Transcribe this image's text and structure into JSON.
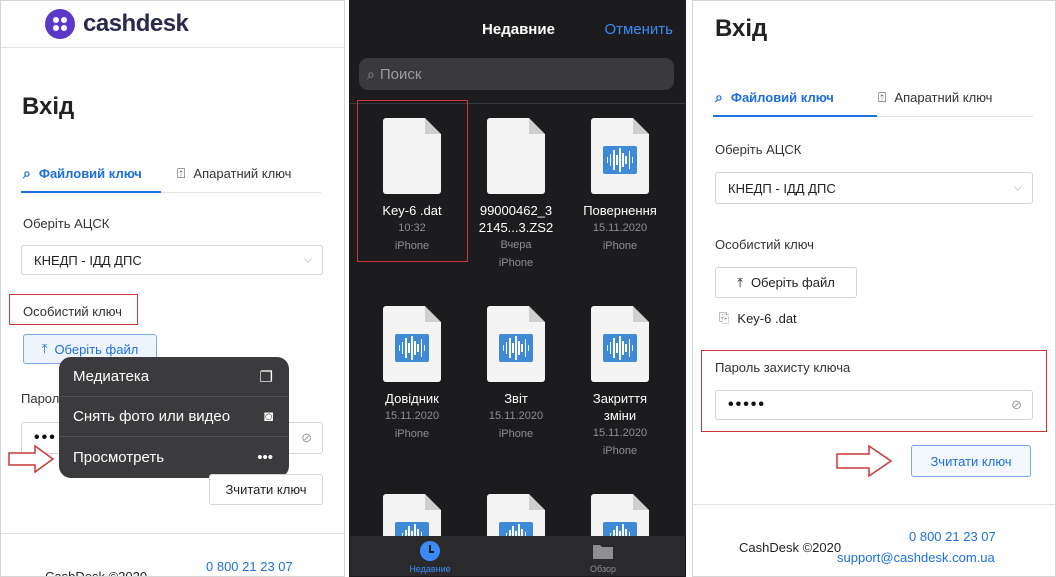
{
  "left_panel": {
    "brand": "cashdesk",
    "title": "Вхід",
    "tabs": [
      {
        "label": "Файловий ключ",
        "active": true
      },
      {
        "label": "Апаратний ключ",
        "active": false
      }
    ],
    "ca_label": "Оберіть АЦСК",
    "ca_value": "КНЕДП - ІДД ДПС",
    "key_label": "Особистий ключ",
    "choose_file": "Оберіть файл",
    "password_label_partial": "Пароль",
    "password_value": "•••",
    "context_menu": [
      {
        "label": "Медиатека",
        "icon": "gallery-icon"
      },
      {
        "label": "Снять фото или видео",
        "icon": "camera-icon"
      },
      {
        "label": "Просмотреть",
        "icon": "more-icon"
      }
    ],
    "read_key_button": "Зчитати ключ",
    "footer_phone": "0 800 21 23 07",
    "footer_copyright": "CashDesk ©2020"
  },
  "middle_panel": {
    "title": "Недавние",
    "cancel": "Отменить",
    "search_placeholder": "Поиск",
    "files": [
      {
        "name": "Key-6 .dat",
        "time": "10:32",
        "source": "iPhone",
        "kind": "doc"
      },
      {
        "name": "99000462_3 2145...3.ZS2",
        "time": "Вчера",
        "source": "iPhone",
        "kind": "doc"
      },
      {
        "name": "Повернення",
        "time": "15.11.2020",
        "source": "iPhone",
        "kind": "audio"
      },
      {
        "name": "Довідник",
        "time": "15.11.2020",
        "source": "iPhone",
        "kind": "audio"
      },
      {
        "name": "Звіт",
        "time": "15.11.2020",
        "source": "iPhone",
        "kind": "audio"
      },
      {
        "name": "Закриття зміни",
        "time": "15.11.2020",
        "source": "iPhone",
        "kind": "audio"
      }
    ],
    "tabbar": [
      {
        "label": "Недавние",
        "active": true
      },
      {
        "label": "Обзор",
        "active": false
      }
    ]
  },
  "right_panel": {
    "title": "Вхід",
    "tabs": [
      {
        "label": "Файловий ключ",
        "active": true
      },
      {
        "label": "Апаратний ключ",
        "active": false
      }
    ],
    "ca_label": "Оберіть АЦСК",
    "ca_value": "КНЕДП - ІДД ДПС",
    "key_label": "Особистий ключ",
    "choose_file": "Оберіть файл",
    "selected_file": "Key-6 .dat",
    "password_label": "Пароль захисту ключа",
    "password_value": "•••••",
    "read_key_button": "Зчитати ключ",
    "footer_copyright": "CashDesk ©2020",
    "footer_phone": "0 800 21 23 07",
    "footer_email": "support@cashdesk.com.ua"
  },
  "colors": {
    "accent": "#1d6fe0",
    "brand": "#5a39c8",
    "highlight": "#c8383a",
    "ios_dark": "#1c1c1e"
  }
}
